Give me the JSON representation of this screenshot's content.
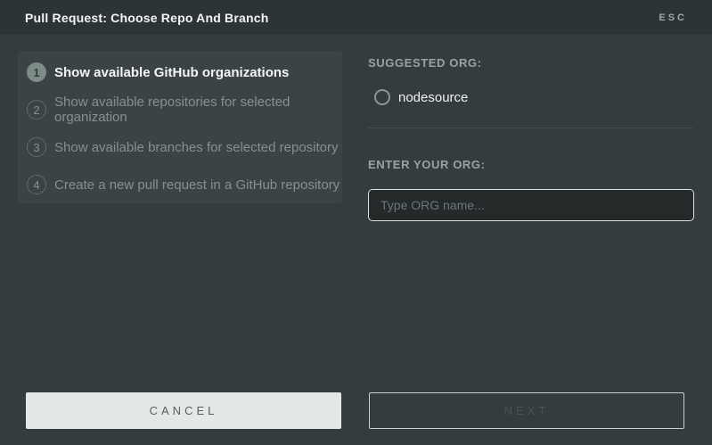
{
  "header": {
    "title": "Pull Request: Choose Repo And Branch",
    "esc_label": "ESC"
  },
  "steps": [
    {
      "number": "1",
      "label": "Show available GitHub organizations",
      "state": "active"
    },
    {
      "number": "2",
      "label": "Show available repositories for selected organization",
      "state": "inactive"
    },
    {
      "number": "3",
      "label": "Show available branches for selected repository",
      "state": "inactive"
    },
    {
      "number": "4",
      "label": "Create a new pull request in a GitHub repository",
      "state": "inactive"
    }
  ],
  "suggested_org": {
    "heading": "SUGGESTED ORG:",
    "options": [
      {
        "label": "nodesource",
        "selected": false
      }
    ]
  },
  "enter_org": {
    "heading": "ENTER YOUR ORG:",
    "placeholder": "Type ORG name...",
    "value": ""
  },
  "footer": {
    "cancel_label": "CANCEL",
    "next_label": "NEXT",
    "next_disabled": true
  },
  "colors": {
    "header_bg": "#2d3435",
    "body_bg": "#353c3d",
    "panel_bg": "#3c4344",
    "active_step_circle": "#7e8b89",
    "cancel_button_bg": "#e4e9e6",
    "input_bg": "#24292a",
    "input_border": "#dde2e1"
  }
}
